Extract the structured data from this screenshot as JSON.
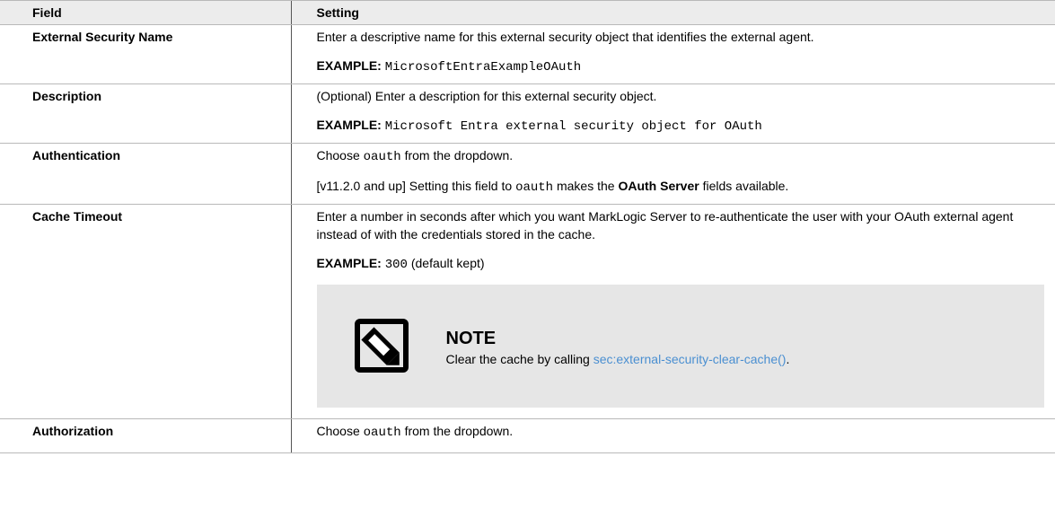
{
  "header": {
    "field": "Field",
    "setting": "Setting"
  },
  "rows": [
    {
      "field": "External Security Name",
      "p1": "Enter a descriptive name for this external security object that identifies the external agent.",
      "example_label": "EXAMPLE:",
      "example_value": "MicrosoftEntraExampleOAuth"
    },
    {
      "field": "Description",
      "p1": "(Optional) Enter a description for this external security object.",
      "example_label": "EXAMPLE:",
      "example_value": "Microsoft Entra external security object for OAuth"
    },
    {
      "field": "Authentication",
      "p1_pre": "Choose",
      "p1_code": "oauth",
      "p1_post": "from the dropdown.",
      "p2_pre": "[v11.2.0 and up] Setting this field to",
      "p2_code": "oauth",
      "p2_mid": "makes the",
      "p2_bold": "OAuth Server",
      "p2_post": "fields available."
    },
    {
      "field": "Cache Timeout",
      "p1": "Enter a number in seconds after which you want MarkLogic Server to re-authenticate the user with your OAuth external agent instead of with the credentials stored in the cache.",
      "example_label": "EXAMPLE:",
      "example_value": "300",
      "example_suffix": "(default kept)",
      "note": {
        "icon": "note-pencil-icon",
        "title": "NOTE",
        "text_pre": "Clear the cache by calling",
        "link": "sec:external-security-clear-cache()",
        "text_post": "."
      }
    },
    {
      "field": "Authorization",
      "p1_pre": "Choose",
      "p1_code": "oauth",
      "p1_post": "from the dropdown."
    }
  ],
  "colors": {
    "header_bg": "#ececec",
    "note_bg": "#e6e6e6",
    "link": "#4a8fd1"
  }
}
